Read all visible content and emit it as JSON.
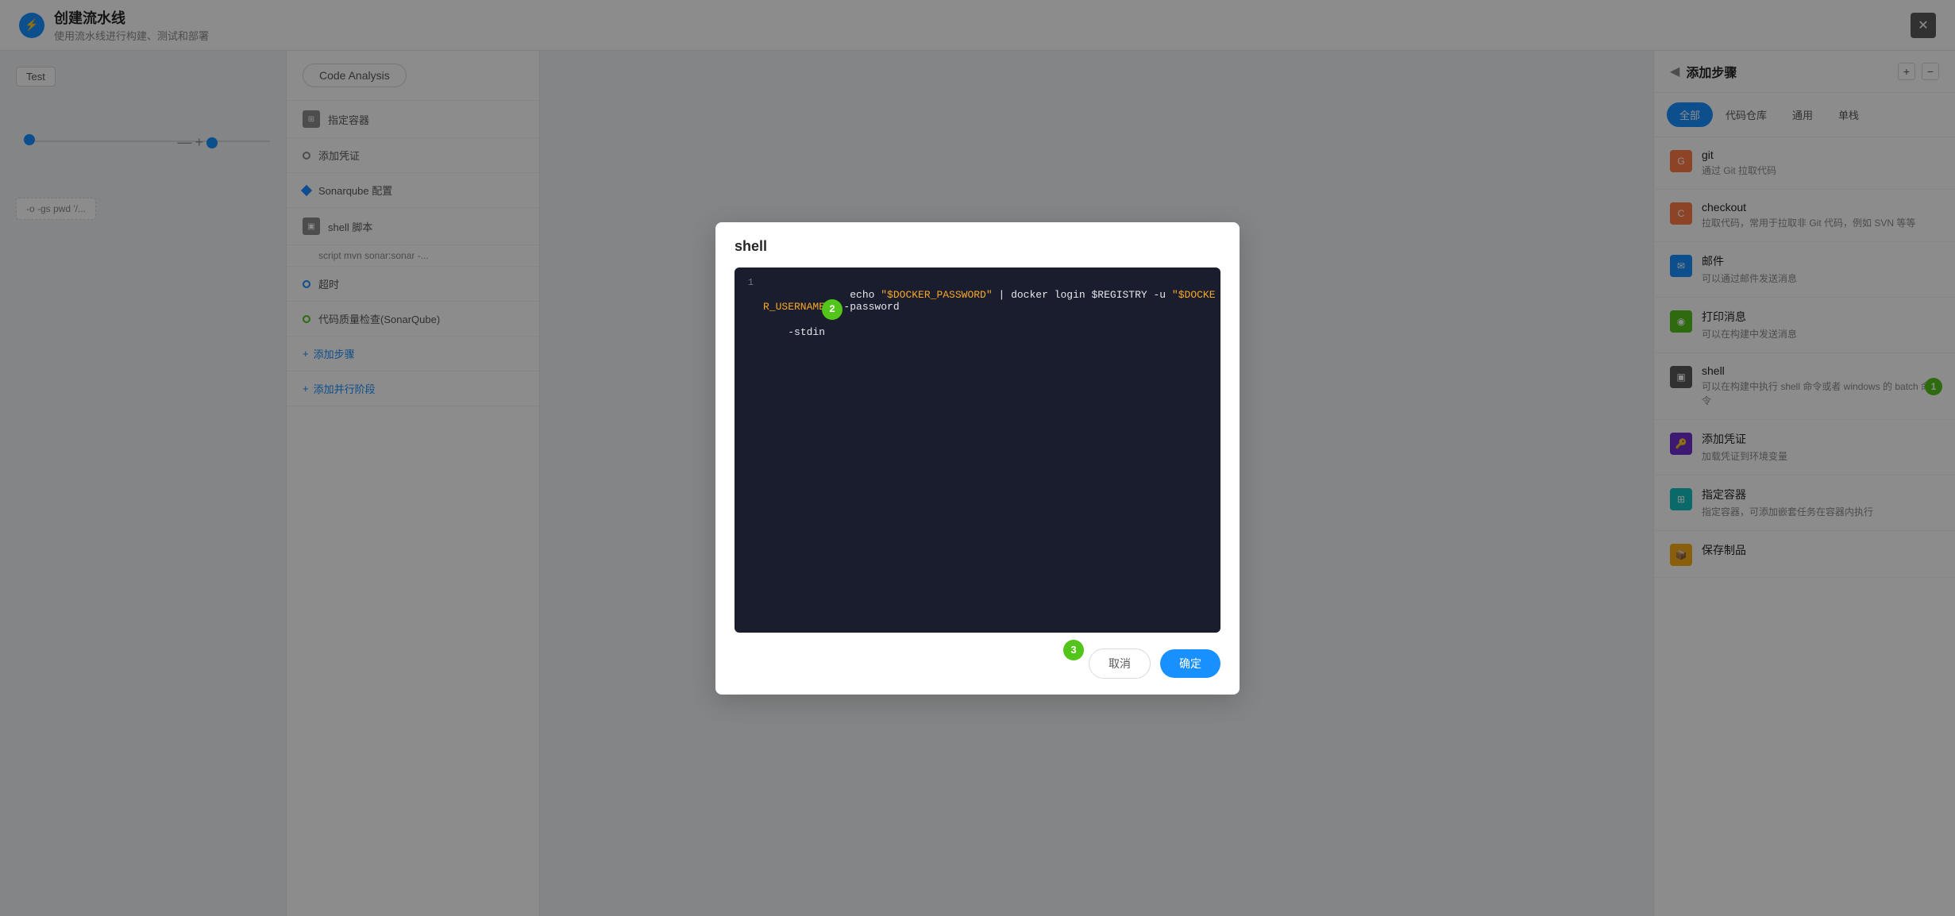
{
  "app": {
    "title": "创建流水线",
    "subtitle": "使用流水线进行构建、测试和部署"
  },
  "header": {
    "close_label": "✕"
  },
  "pipeline": {
    "stages": [
      "Test",
      "Code Analysis"
    ]
  },
  "left_panel": {
    "test_label": "Test",
    "connector_text": "-o -gs  pwd '/..."
  },
  "code_analysis_col": {
    "header_btn": "Code Analysis",
    "items": [
      {
        "icon": "grid",
        "label": "指定容器"
      },
      {
        "icon": "circle",
        "label": "添加凭证"
      },
      {
        "icon": "diamond",
        "label": "Sonarqube 配置"
      },
      {
        "icon": "terminal",
        "label": "shell 脚本"
      },
      {
        "sub": "script   mvn sonar:sonar -..."
      },
      {
        "icon": "clock",
        "label": "超时"
      },
      {
        "icon": "circle2",
        "label": "代码质量检查(SonarQube)"
      }
    ],
    "add_step": "添加步骤",
    "add_parallel": "添加并行阶段"
  },
  "right_sidebar": {
    "title": "添加步骤",
    "tabs": [
      "全部",
      "代码仓库",
      "通用",
      "单栈"
    ],
    "items": [
      {
        "name": "git",
        "desc": "通过 Git 拉取代码",
        "icon_type": "git"
      },
      {
        "name": "checkout",
        "desc": "拉取代码，常用于拉取非 Git 代码，例如 SVN 等等",
        "icon_type": "checkout"
      },
      {
        "name": "邮件",
        "desc": "可以通过邮件发送消息",
        "icon_type": "mail"
      },
      {
        "name": "打印消息",
        "desc": "可以在构建中发送消息",
        "icon_type": "print"
      },
      {
        "name": "shell",
        "desc": "可以在构建中执行 shell 命令或者 windows 的 batch 命令",
        "icon_type": "shell",
        "badge": "1"
      },
      {
        "name": "添加凭证",
        "desc": "加载凭证到环境变量",
        "icon_type": "cred"
      },
      {
        "name": "指定容器",
        "desc": "指定容器，可添加嵌套任务在容器内执行",
        "icon_type": "container"
      },
      {
        "name": "保存制品",
        "desc": "",
        "icon_type": "save"
      }
    ]
  },
  "modal": {
    "title": "shell",
    "code_line1": {
      "number": "1",
      "prefix": "echo ",
      "string1": "\"$DOCKER_PASSWORD\"",
      "middle": " | docker login $REGISTRY -u ",
      "string2": "\"$DOCKER_USERNAME\"",
      "suffix": " --password"
    },
    "code_line2": {
      "number": "",
      "content": "    -stdin"
    },
    "badge2": "2",
    "cancel_label": "取消",
    "confirm_label": "确定",
    "badge3": "3"
  }
}
